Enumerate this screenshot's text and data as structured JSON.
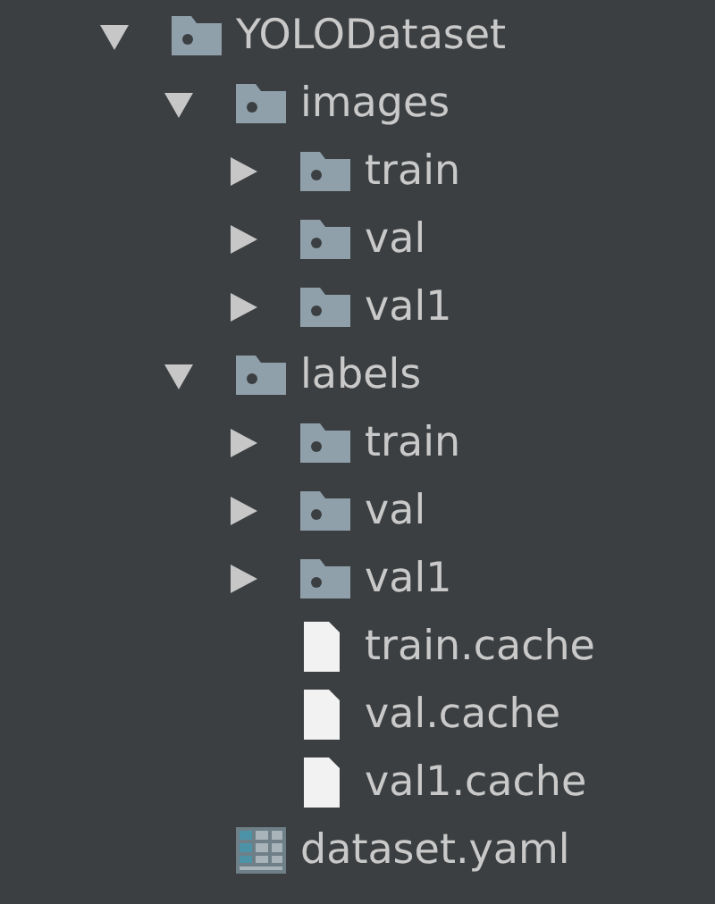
{
  "tree": [
    {
      "name": "YOLODataset",
      "kind": "folder",
      "expanded": true,
      "children": [
        {
          "name": "images",
          "kind": "folder",
          "expanded": true,
          "children": [
            {
              "name": "train",
              "kind": "folder",
              "expanded": false
            },
            {
              "name": "val",
              "kind": "folder",
              "expanded": false
            },
            {
              "name": "val1",
              "kind": "folder",
              "expanded": false
            }
          ]
        },
        {
          "name": "labels",
          "kind": "folder",
          "expanded": true,
          "children": [
            {
              "name": "train",
              "kind": "folder",
              "expanded": false
            },
            {
              "name": "val",
              "kind": "folder",
              "expanded": false
            },
            {
              "name": "val1",
              "kind": "folder",
              "expanded": false
            },
            {
              "name": "train.cache",
              "kind": "file"
            },
            {
              "name": "val.cache",
              "kind": "file"
            },
            {
              "name": "val1.cache",
              "kind": "file"
            }
          ]
        },
        {
          "name": "dataset.yaml",
          "kind": "table"
        }
      ]
    }
  ]
}
